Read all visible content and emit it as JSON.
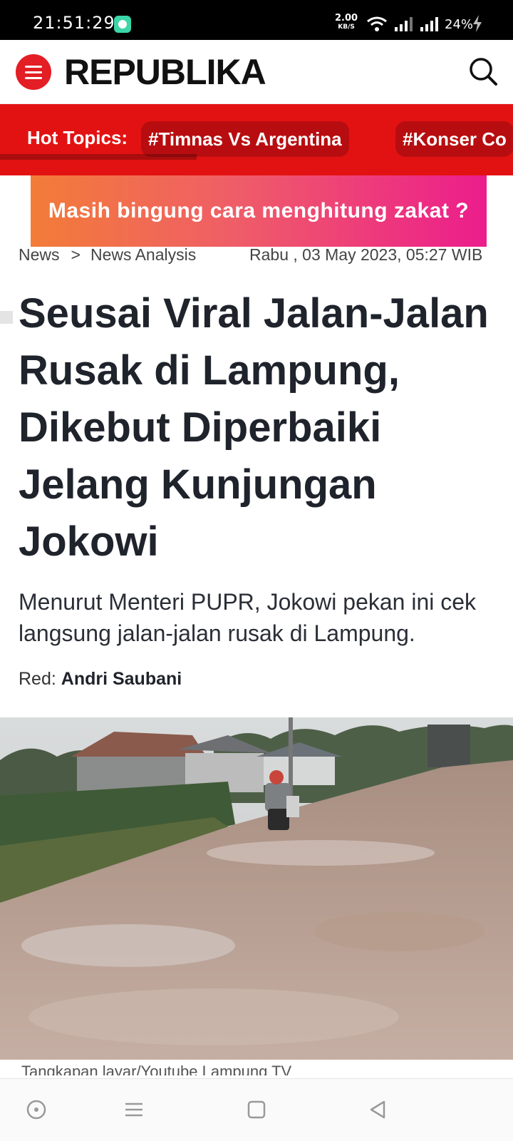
{
  "status_bar": {
    "time": "21:51:29",
    "speed_value": "2.00",
    "speed_unit": "KB/S",
    "battery": "24%"
  },
  "header": {
    "logo": "REPUBLIKA",
    "accent_color": "#e31e24"
  },
  "hot_topics": {
    "label": "Hot Topics:",
    "items": [
      "#Timnas Vs Argentina",
      "#Konser Co"
    ]
  },
  "banner": {
    "text": "Masih bingung cara menghitung zakat ?"
  },
  "breadcrumb": {
    "items": [
      "News",
      "News Analysis"
    ],
    "separator": ">"
  },
  "article": {
    "date": "Rabu , 03 May 2023, 05:27 WIB",
    "title": "Seusai Viral Jalan-Jalan Rusak di Lampung, Dikebut Diperbaiki Jelang Kunjungan Jokowi",
    "subtitle": "Menurut Menteri PUPR, Jokowi pekan ini cek langsung jalan-jalan rusak di Lampung.",
    "editor_label": "Red:",
    "editor_name": "Andri Saubani",
    "caption": "Tangkapan layar/Youtube Lampung TV"
  },
  "nav": {
    "icons": [
      "circle-nav-icon",
      "menu-lines-icon",
      "home-square-icon",
      "back-triangle-icon"
    ]
  }
}
